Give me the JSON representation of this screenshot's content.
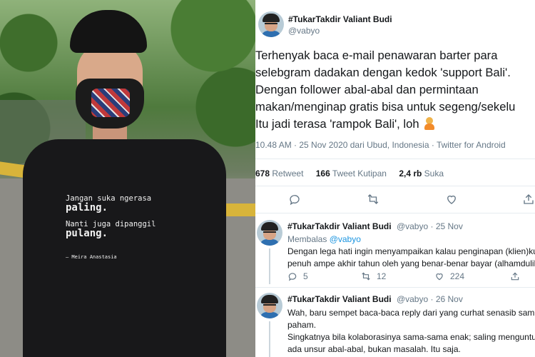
{
  "photo": {
    "shirt_line1": "Jangan suka ngerasa",
    "shirt_line2": "paling.",
    "shirt_line3": "Nanti juga dipanggil",
    "shirt_line4": "pulang.",
    "shirt_signature": "— Meira Anastasia"
  },
  "tweet": {
    "name": "#TukarTakdir Valiant Budi",
    "handle": "@vabyo",
    "lines": [
      "Terhenyak baca e-mail penawaran barter para",
      "selebgram dadakan dengan kedok 'support Bali'.",
      "Dengan follower abal-abal dan permintaan",
      "makan/menginap gratis bisa untuk segeng/sekelu",
      "Itu jadi terasa 'rampok Bali', loh"
    ],
    "meta": "10.48 AM · 25 Nov 2020 dari Ubud, Indonesia · Twitter for Android",
    "retweets_count": "678",
    "retweets_label": "Retweet",
    "quotes_count": "166",
    "quotes_label": "Tweet Kutipan",
    "likes_count": "2,4 rb",
    "likes_label": "Suka"
  },
  "replies": [
    {
      "name": "#TukarTakdir Valiant Budi",
      "handle": "@vabyo",
      "date": "· 25 Nov",
      "replying_label": "Membalas",
      "replying_to": "@vabyo",
      "lines": [
        "Dengan lega hati ingin menyampaikan kalau penginapan (klien)ku i",
        "penuh ampe akhir tahun oleh yang benar-benar bayar (alhamdulilla"
      ],
      "replies": "5",
      "retweets": "12",
      "likes": "224"
    },
    {
      "name": "#TukarTakdir Valiant Budi",
      "handle": "@vabyo",
      "date": "· 26 Nov",
      "lines": [
        "Wah, baru sempet baca-baca reply dari yang curhat senasib sampai",
        "paham.",
        "Singkatnya bila kolaborasinya sama-sama enak; saling menguntung",
        "ada unsur abal-abal, bukan masalah. Itu saja."
      ]
    }
  ],
  "icons": [
    "reply-icon",
    "retweet-icon",
    "like-icon",
    "share-icon"
  ],
  "colors": {
    "link": "#1b95e0",
    "muted": "#657786",
    "divider": "#e6ecf0"
  }
}
